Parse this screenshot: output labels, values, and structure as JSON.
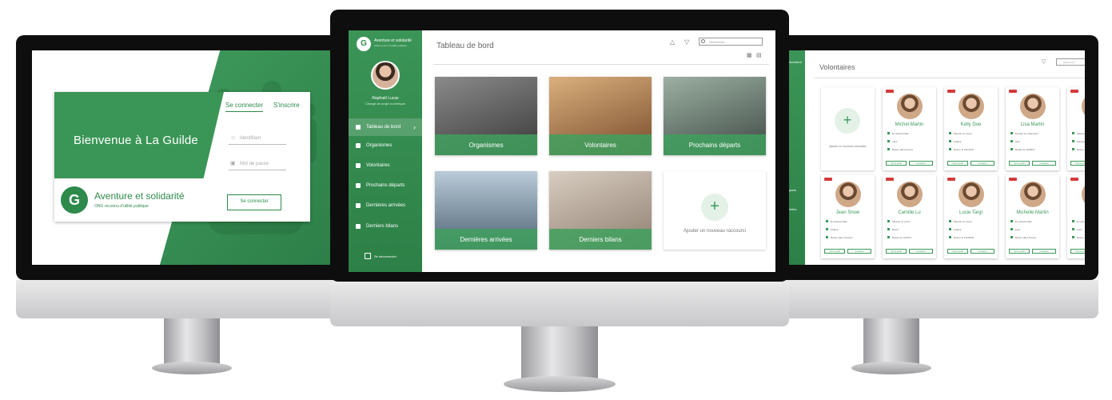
{
  "login": {
    "welcome": "Bienvenue à La Guilde",
    "brand_logo_text": "La Guilde",
    "brand_name": "Aventure et solidarité",
    "brand_sub": "ONG reconnu d'utilité publique",
    "tab_login": "Se connecter",
    "tab_signup": "S'inscrire",
    "id_placeholder": "Identifiant",
    "pwd_placeholder": "Mot de passe",
    "submit": "Se connecter"
  },
  "dashboard": {
    "brand_name": "Aventure et solidarité",
    "brand_sub": "ONG reconnu d'utilité publique",
    "user_name": "Raphaël Lucas",
    "user_role": "Chargé de projet numérique",
    "nav": [
      {
        "label": "Tableau de bord",
        "active": true
      },
      {
        "label": "Organismes"
      },
      {
        "label": "Volontaires"
      },
      {
        "label": "Prochains départs"
      },
      {
        "label": "Dernières arrivées"
      },
      {
        "label": "Derniers bilans"
      }
    ],
    "logout": "Se déconnecter",
    "title": "Tableau de bord",
    "search_placeholder": "Recherche...",
    "tiles": [
      {
        "label": "Organismes",
        "color": "#5d5d5d"
      },
      {
        "label": "Volontaires",
        "color": "#b07a48"
      },
      {
        "label": "Prochains départs",
        "color": "#6b7c70"
      },
      {
        "label": "Dernières arrivées",
        "color": "#6d8497"
      },
      {
        "label": "Derniers bilans",
        "color": "#a99b8e"
      }
    ],
    "add_shortcut": "Ajouter un nouveau raccourci"
  },
  "volunteers": {
    "title": "Volontaires",
    "search_placeholder": "Recherche",
    "add_label": "Ajouter un nouveau volontaire",
    "sidebar_labels": [
      "Aventure",
      "parts",
      "ivées"
    ],
    "cards_row1": [
      {
        "name": "Michel Martin",
        "l1": "En attente bilan",
        "l2": "Laos",
        "l3": "Retour dans 6 jours"
      },
      {
        "name": "Kelly Doe",
        "l1": "Mission en cours",
        "l2": "Afrique",
        "l3": "Retour le 22/12/18"
      },
      {
        "name": "Lisa Martin",
        "l1": "Dossier en traitement",
        "l2": "Asie",
        "l3": "Départ le 12/08/17"
      },
      {
        "name": "Basi",
        "l1": "Mission",
        "l2": "Mexique",
        "l3": "Retour"
      }
    ],
    "cards_row2": [
      {
        "name": "Jean Snow",
        "l1": "En attente bilan",
        "l2": "Afrique",
        "l3": "Retour dans 15 jours"
      },
      {
        "name": "Camille Lu",
        "l1": "Mission en cours",
        "l2": "Brésil",
        "l3": "Retour le 11/10/17"
      },
      {
        "name": "Lucie Targi",
        "l1": "Mission en cours",
        "l2": "Afrique",
        "l3": "Retour le 14/08/18"
      },
      {
        "name": "Michelle Martin",
        "l1": "En attente bilan",
        "l2": "Laos",
        "l3": "Retour dans 8 jours"
      },
      {
        "name": "Mauri",
        "l1": "En atte",
        "l2": "Laos",
        "l3": "Retour"
      }
    ],
    "btn_profile": "Voir le profil",
    "btn_contact": "Contacter"
  }
}
